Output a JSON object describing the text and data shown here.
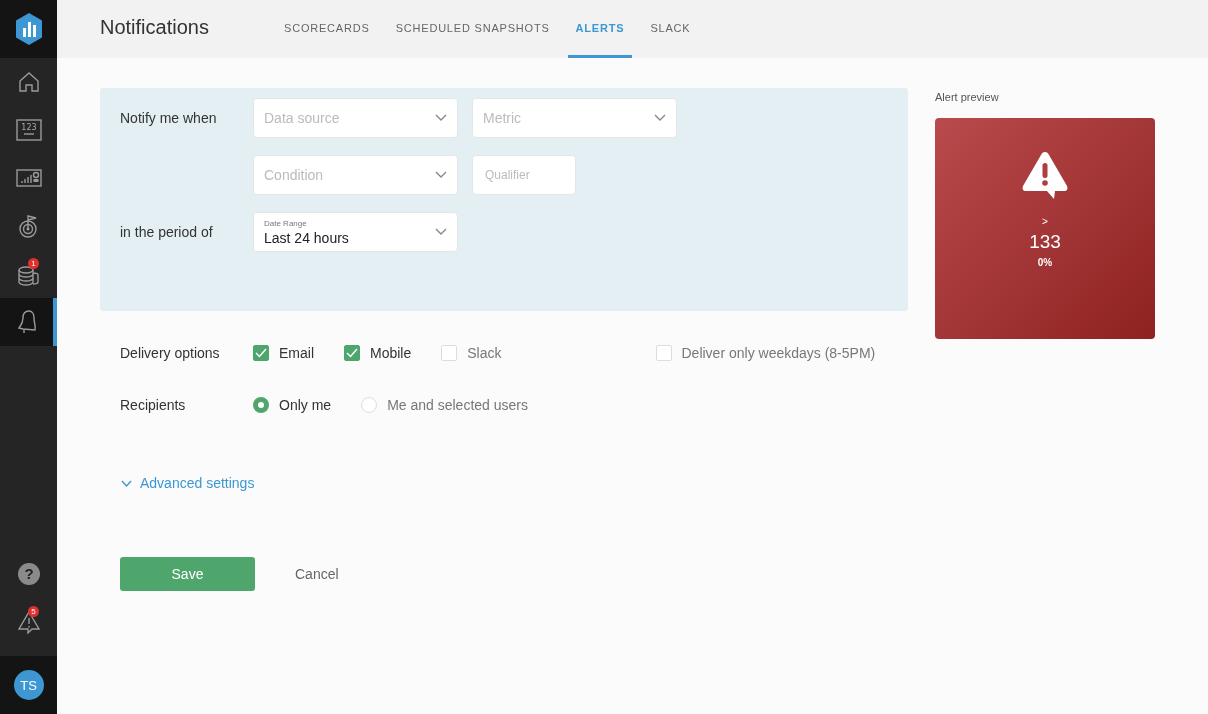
{
  "sidebar": {
    "items": [
      {
        "kind": "home",
        "selected": false
      },
      {
        "kind": "numbers",
        "selected": false,
        "icon_text": "123"
      },
      {
        "kind": "dashboard",
        "selected": false
      },
      {
        "kind": "goals",
        "selected": false
      },
      {
        "kind": "databases",
        "selected": false,
        "badge": "1"
      },
      {
        "kind": "bell",
        "selected": true
      }
    ],
    "bottom": [
      {
        "kind": "help",
        "icon_text": "?"
      },
      {
        "kind": "alert",
        "badge": "5"
      }
    ],
    "avatar": "TS"
  },
  "header": {
    "title": "Notifications",
    "tabs": [
      {
        "label": "SCORECARDS",
        "selected": false
      },
      {
        "label": "SCHEDULED SNAPSHOTS",
        "selected": false
      },
      {
        "label": "ALERTS",
        "selected": true
      },
      {
        "label": "SLACK",
        "selected": false
      }
    ]
  },
  "form": {
    "rows": [
      {
        "label": "Notify me when",
        "fields": [
          {
            "kind": "select",
            "placeholder": "Data source"
          },
          {
            "kind": "select",
            "placeholder": "Metric"
          }
        ]
      },
      {
        "label": "",
        "fields": [
          {
            "kind": "select",
            "placeholder": "Condition"
          },
          {
            "kind": "input",
            "placeholder": "Qualifier"
          }
        ]
      },
      {
        "label": "in the period of",
        "fields": [
          {
            "kind": "select",
            "floating_label": "Date Range",
            "value": "Last 24 hours"
          }
        ]
      }
    ]
  },
  "delivery": {
    "label": "Delivery options",
    "options": [
      {
        "label": "Email",
        "checked": true
      },
      {
        "label": "Mobile",
        "checked": true
      },
      {
        "label": "Slack",
        "checked": false
      }
    ],
    "weekdays": {
      "label": "Deliver only weekdays (8-5PM)",
      "checked": false
    }
  },
  "recipients": {
    "label": "Recipients",
    "options": [
      {
        "label": "Only me",
        "selected": true
      },
      {
        "label": "Me and selected users",
        "selected": false
      }
    ]
  },
  "advanced": {
    "label": "Advanced settings",
    "expanded": false
  },
  "buttons": {
    "save": "Save",
    "cancel": "Cancel"
  },
  "preview": {
    "title": "Alert preview",
    "operator": ">",
    "value": "133",
    "change": "0%"
  }
}
